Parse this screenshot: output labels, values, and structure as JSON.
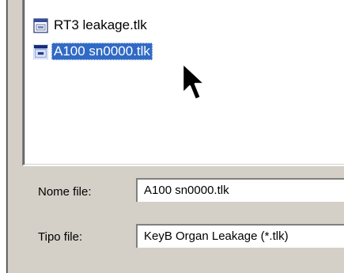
{
  "file_list": {
    "items": [
      {
        "name": "RT3 leakage.tlk",
        "selected": false
      },
      {
        "name": "A100 sn0000.tlk",
        "selected": true
      }
    ]
  },
  "filename": {
    "label": "Nome file:",
    "value": "A100 sn0000.tlk"
  },
  "filetype": {
    "label": "Tipo file:",
    "value": "KeyB Organ Leakage (*.tlk)"
  },
  "icons": {
    "file": "document-icon",
    "cursor": "mouse-pointer-icon"
  },
  "colors": {
    "selection": "#316ac5",
    "dialog_bg": "#d4d0c8"
  }
}
